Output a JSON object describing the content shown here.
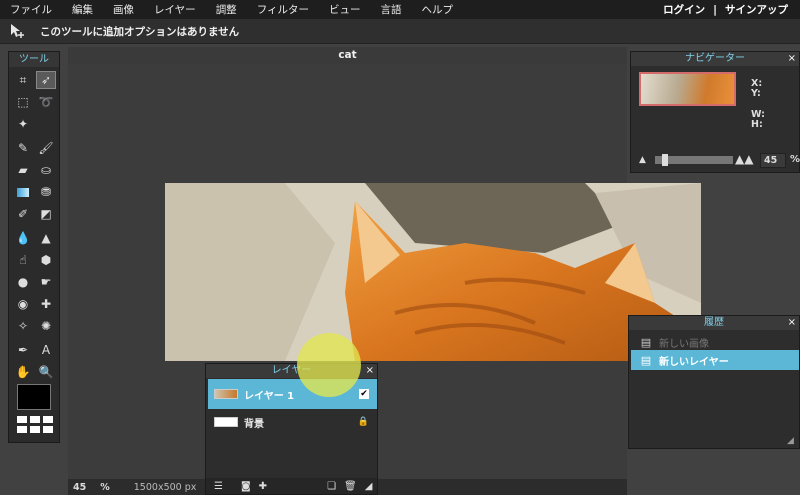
{
  "menu": [
    "ファイル",
    "編集",
    "画像",
    "レイヤー",
    "調整",
    "フィルター",
    "ビュー",
    "言語",
    "ヘルプ"
  ],
  "auth": {
    "login": "ログイン",
    "sep": "|",
    "signup": "サインアップ"
  },
  "options": {
    "text": "このツールに追加オプションはありません",
    "icon": "move-plus-icon"
  },
  "tools": {
    "title": "ツール"
  },
  "canvas": {
    "title": "cat"
  },
  "status": {
    "zoom": "45",
    "pct": "%",
    "dims": "1500x500 px"
  },
  "navigator": {
    "title": "ナビゲーター",
    "close": "×",
    "x_label": "X:",
    "y_label": "Y:",
    "w_label": "W:",
    "h_label": "H:",
    "zoom": "45",
    "pct": "%",
    "zoom_level": 0.05
  },
  "history": {
    "title": "履歴",
    "close": "×",
    "items": [
      {
        "label": "新しい画像",
        "state": "dim"
      },
      {
        "label": "新しいレイヤー",
        "state": "selected"
      }
    ]
  },
  "layers": {
    "title": "レイヤー",
    "close": "×",
    "items": [
      {
        "label": "レイヤー 1",
        "selected": true,
        "checked": true
      },
      {
        "label": "背景",
        "selected": false,
        "locked": true
      }
    ]
  },
  "colors": {
    "accent": "#5bb7d5",
    "header_text": "#7fd0ea"
  }
}
